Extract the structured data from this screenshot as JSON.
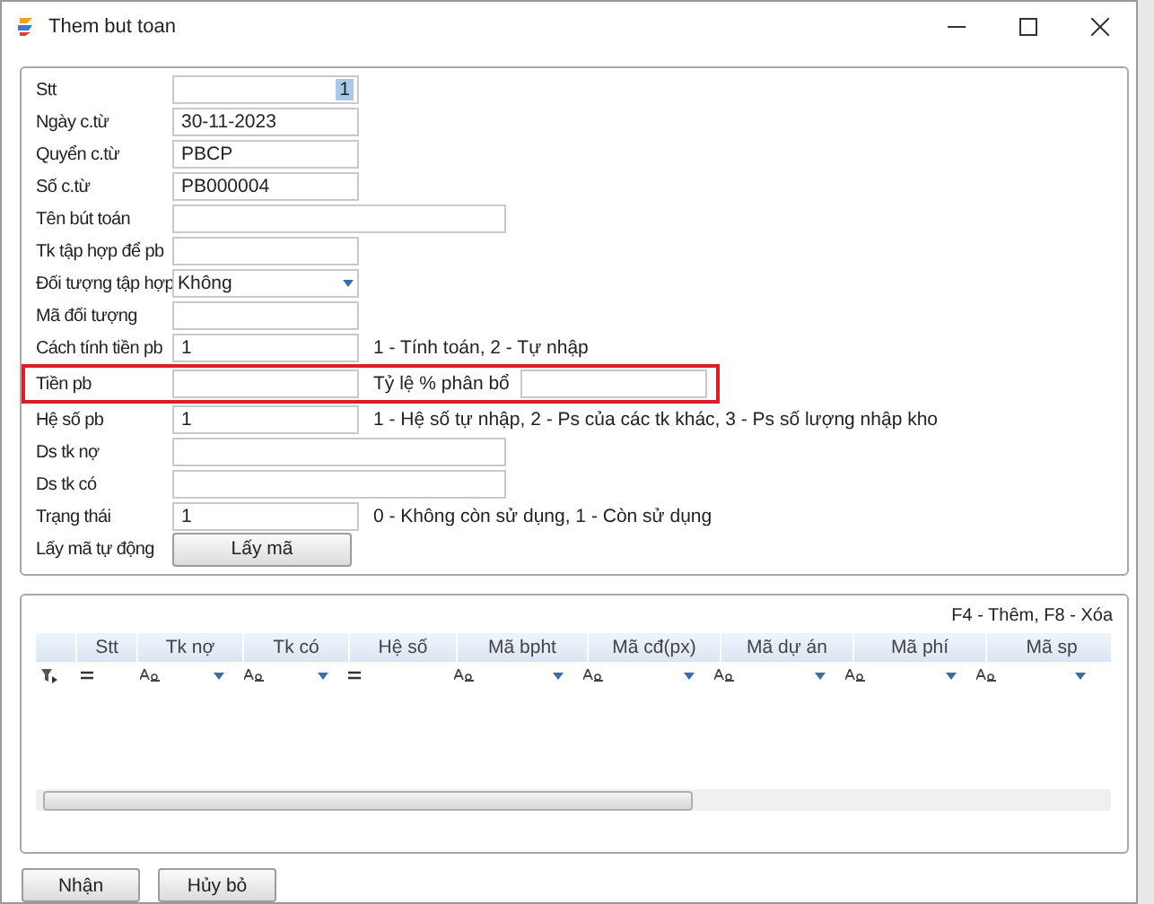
{
  "window": {
    "title": "Them but toan"
  },
  "form": {
    "rows": [
      {
        "label": "Stt",
        "kind": "number",
        "value": "1",
        "value_selected": true
      },
      {
        "label": "Ngày c.từ",
        "kind": "short",
        "value": "30-11-2023"
      },
      {
        "label": "Quyển c.từ",
        "kind": "short",
        "value": "PBCP"
      },
      {
        "label": "Số c.từ",
        "kind": "short",
        "value": "PB000004"
      },
      {
        "label": "Tên bút toán",
        "kind": "long"
      },
      {
        "label": "Tk tập hợp để pb",
        "kind": "short"
      },
      {
        "label": "Đối tượng tập hợp",
        "kind": "select",
        "value": "Không"
      },
      {
        "label": "Mã đối tượng",
        "kind": "short"
      },
      {
        "label": "Cách tính tiền pb",
        "kind": "short",
        "value": "1",
        "note": "1 - Tính toán, 2 - Tự nhập"
      },
      {
        "label": "Tiền pb",
        "kind": "short",
        "highlighted": true,
        "extra_label": "Tỷ lệ % phân bổ"
      },
      {
        "label": "Hệ số pb",
        "kind": "short",
        "value": "1",
        "note": "1 - Hệ số tự nhập, 2 - Ps của các tk khác, 3 - Ps số lượng nhập kho"
      },
      {
        "label": "Ds tk nợ",
        "kind": "long"
      },
      {
        "label": "Ds tk có",
        "kind": "long"
      },
      {
        "label": "Trạng thái",
        "kind": "short",
        "value": "1",
        "note": "0 - Không còn sử dụng, 1 - Còn sử dụng"
      },
      {
        "label": "Lấy mã tự động",
        "kind": "button",
        "value": "Lấy mã"
      }
    ]
  },
  "grid": {
    "hint": "F4 - Thêm, F8 - Xóa",
    "columns": [
      {
        "title": "Stt",
        "kind": "equals"
      },
      {
        "title": "Tk nợ",
        "kind": "text"
      },
      {
        "title": "Tk có",
        "kind": "text"
      },
      {
        "title": "Hệ số",
        "kind": "equals"
      },
      {
        "title": "Mã bpht",
        "kind": "text"
      },
      {
        "title": "Mã cđ(px)",
        "kind": "text"
      },
      {
        "title": "Mã dự án",
        "kind": "text"
      },
      {
        "title": "Mã phí",
        "kind": "text"
      },
      {
        "title": "Mã sp",
        "kind": "text"
      }
    ]
  },
  "buttons": [
    "Nhận",
    "Hủy bỏ"
  ]
}
